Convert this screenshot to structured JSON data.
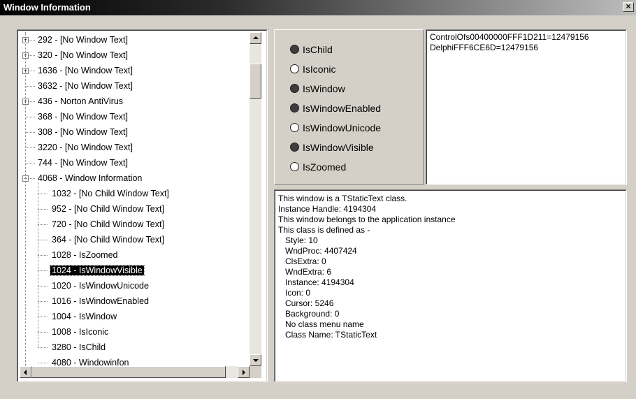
{
  "window": {
    "title": "Window Information",
    "close_glyph": "×"
  },
  "tree": {
    "items": [
      {
        "label": "292 - [No Window Text]",
        "expander": "+"
      },
      {
        "label": "320 - [No Window Text]",
        "expander": "+"
      },
      {
        "label": "1636 - [No Window Text]",
        "expander": "+"
      },
      {
        "label": "3632 - [No Window Text]",
        "expander": ""
      },
      {
        "label": "436 - Norton AntiVirus",
        "expander": "+"
      },
      {
        "label": "368 - [No Window Text]",
        "expander": ""
      },
      {
        "label": "308 - [No Window Text]",
        "expander": ""
      },
      {
        "label": "3220 - [No Window Text]",
        "expander": ""
      },
      {
        "label": "744 - [No Window Text]",
        "expander": ""
      },
      {
        "label": "4068 - Window Information",
        "expander": "−"
      },
      {
        "label": "1032 - [No Child Window Text]",
        "expander": ""
      },
      {
        "label": "952 - [No Child Window Text]",
        "expander": ""
      },
      {
        "label": "720 - [No Child Window Text]",
        "expander": ""
      },
      {
        "label": "364 - [No Child Window Text]",
        "expander": ""
      },
      {
        "label": "1028 - IsZoomed",
        "expander": ""
      },
      {
        "label": "1024 - IsWindowVisible",
        "expander": "",
        "selected": true
      },
      {
        "label": "1020 - IsWindowUnicode",
        "expander": ""
      },
      {
        "label": "1016 - IsWindowEnabled",
        "expander": ""
      },
      {
        "label": "1004 - IsWindow",
        "expander": ""
      },
      {
        "label": "1008 - IsIconic",
        "expander": ""
      },
      {
        "label": "3280 - IsChild",
        "expander": ""
      },
      {
        "label": "4080 - Windowinfon",
        "expander": ""
      }
    ]
  },
  "flags": [
    {
      "label": "IsChild",
      "checked": true
    },
    {
      "label": "IsIconic",
      "checked": false
    },
    {
      "label": "IsWindow",
      "checked": true
    },
    {
      "label": "IsWindowEnabled",
      "checked": true
    },
    {
      "label": "IsWindowUnicode",
      "checked": false
    },
    {
      "label": "IsWindowVisible",
      "checked": true
    },
    {
      "label": "IsZoomed",
      "checked": false
    }
  ],
  "properties_text": "ControlOfs00400000FFF1D211=12479156\nDelphiFFF6CE6D=12479156",
  "class_info_text": "This window is a TStaticText class.\nInstance Handle: 4194304\nThis window belongs to the application instance\nThis class is defined as -\n   Style: 10\n   WndProc: 4407424\n   ClsExtra: 0\n   WndExtra: 6\n   Instance: 4194304\n   Icon: 0\n   Cursor: 5246\n   Background: 0\n   No class menu name\n   Class Name: TStaticText"
}
